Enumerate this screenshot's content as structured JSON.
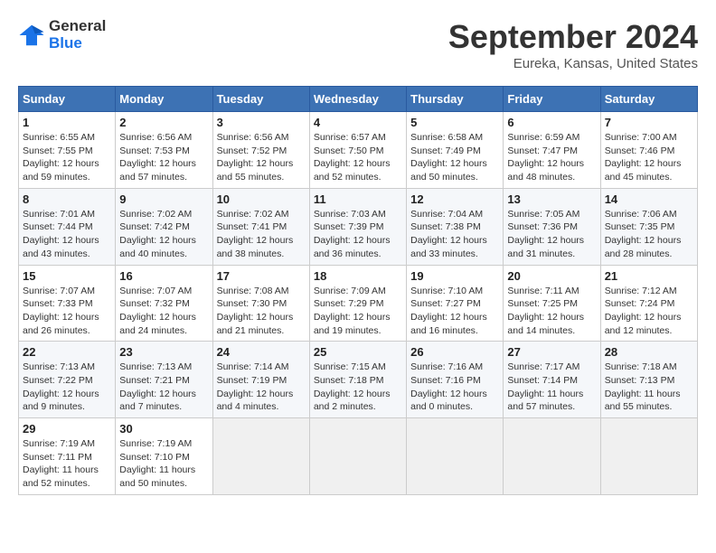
{
  "header": {
    "logo_line1": "General",
    "logo_line2": "Blue",
    "title": "September 2024",
    "subtitle": "Eureka, Kansas, United States"
  },
  "calendar": {
    "days_of_week": [
      "Sunday",
      "Monday",
      "Tuesday",
      "Wednesday",
      "Thursday",
      "Friday",
      "Saturday"
    ],
    "weeks": [
      [
        {
          "day": "1",
          "details": "Sunrise: 6:55 AM\nSunset: 7:55 PM\nDaylight: 12 hours\nand 59 minutes."
        },
        {
          "day": "2",
          "details": "Sunrise: 6:56 AM\nSunset: 7:53 PM\nDaylight: 12 hours\nand 57 minutes."
        },
        {
          "day": "3",
          "details": "Sunrise: 6:56 AM\nSunset: 7:52 PM\nDaylight: 12 hours\nand 55 minutes."
        },
        {
          "day": "4",
          "details": "Sunrise: 6:57 AM\nSunset: 7:50 PM\nDaylight: 12 hours\nand 52 minutes."
        },
        {
          "day": "5",
          "details": "Sunrise: 6:58 AM\nSunset: 7:49 PM\nDaylight: 12 hours\nand 50 minutes."
        },
        {
          "day": "6",
          "details": "Sunrise: 6:59 AM\nSunset: 7:47 PM\nDaylight: 12 hours\nand 48 minutes."
        },
        {
          "day": "7",
          "details": "Sunrise: 7:00 AM\nSunset: 7:46 PM\nDaylight: 12 hours\nand 45 minutes."
        }
      ],
      [
        {
          "day": "8",
          "details": "Sunrise: 7:01 AM\nSunset: 7:44 PM\nDaylight: 12 hours\nand 43 minutes."
        },
        {
          "day": "9",
          "details": "Sunrise: 7:02 AM\nSunset: 7:42 PM\nDaylight: 12 hours\nand 40 minutes."
        },
        {
          "day": "10",
          "details": "Sunrise: 7:02 AM\nSunset: 7:41 PM\nDaylight: 12 hours\nand 38 minutes."
        },
        {
          "day": "11",
          "details": "Sunrise: 7:03 AM\nSunset: 7:39 PM\nDaylight: 12 hours\nand 36 minutes."
        },
        {
          "day": "12",
          "details": "Sunrise: 7:04 AM\nSunset: 7:38 PM\nDaylight: 12 hours\nand 33 minutes."
        },
        {
          "day": "13",
          "details": "Sunrise: 7:05 AM\nSunset: 7:36 PM\nDaylight: 12 hours\nand 31 minutes."
        },
        {
          "day": "14",
          "details": "Sunrise: 7:06 AM\nSunset: 7:35 PM\nDaylight: 12 hours\nand 28 minutes."
        }
      ],
      [
        {
          "day": "15",
          "details": "Sunrise: 7:07 AM\nSunset: 7:33 PM\nDaylight: 12 hours\nand 26 minutes."
        },
        {
          "day": "16",
          "details": "Sunrise: 7:07 AM\nSunset: 7:32 PM\nDaylight: 12 hours\nand 24 minutes."
        },
        {
          "day": "17",
          "details": "Sunrise: 7:08 AM\nSunset: 7:30 PM\nDaylight: 12 hours\nand 21 minutes."
        },
        {
          "day": "18",
          "details": "Sunrise: 7:09 AM\nSunset: 7:29 PM\nDaylight: 12 hours\nand 19 minutes."
        },
        {
          "day": "19",
          "details": "Sunrise: 7:10 AM\nSunset: 7:27 PM\nDaylight: 12 hours\nand 16 minutes."
        },
        {
          "day": "20",
          "details": "Sunrise: 7:11 AM\nSunset: 7:25 PM\nDaylight: 12 hours\nand 14 minutes."
        },
        {
          "day": "21",
          "details": "Sunrise: 7:12 AM\nSunset: 7:24 PM\nDaylight: 12 hours\nand 12 minutes."
        }
      ],
      [
        {
          "day": "22",
          "details": "Sunrise: 7:13 AM\nSunset: 7:22 PM\nDaylight: 12 hours\nand 9 minutes."
        },
        {
          "day": "23",
          "details": "Sunrise: 7:13 AM\nSunset: 7:21 PM\nDaylight: 12 hours\nand 7 minutes."
        },
        {
          "day": "24",
          "details": "Sunrise: 7:14 AM\nSunset: 7:19 PM\nDaylight: 12 hours\nand 4 minutes."
        },
        {
          "day": "25",
          "details": "Sunrise: 7:15 AM\nSunset: 7:18 PM\nDaylight: 12 hours\nand 2 minutes."
        },
        {
          "day": "26",
          "details": "Sunrise: 7:16 AM\nSunset: 7:16 PM\nDaylight: 12 hours\nand 0 minutes."
        },
        {
          "day": "27",
          "details": "Sunrise: 7:17 AM\nSunset: 7:14 PM\nDaylight: 11 hours\nand 57 minutes."
        },
        {
          "day": "28",
          "details": "Sunrise: 7:18 AM\nSunset: 7:13 PM\nDaylight: 11 hours\nand 55 minutes."
        }
      ],
      [
        {
          "day": "29",
          "details": "Sunrise: 7:19 AM\nSunset: 7:11 PM\nDaylight: 11 hours\nand 52 minutes."
        },
        {
          "day": "30",
          "details": "Sunrise: 7:19 AM\nSunset: 7:10 PM\nDaylight: 11 hours\nand 50 minutes."
        },
        {
          "day": "",
          "details": ""
        },
        {
          "day": "",
          "details": ""
        },
        {
          "day": "",
          "details": ""
        },
        {
          "day": "",
          "details": ""
        },
        {
          "day": "",
          "details": ""
        }
      ]
    ]
  }
}
